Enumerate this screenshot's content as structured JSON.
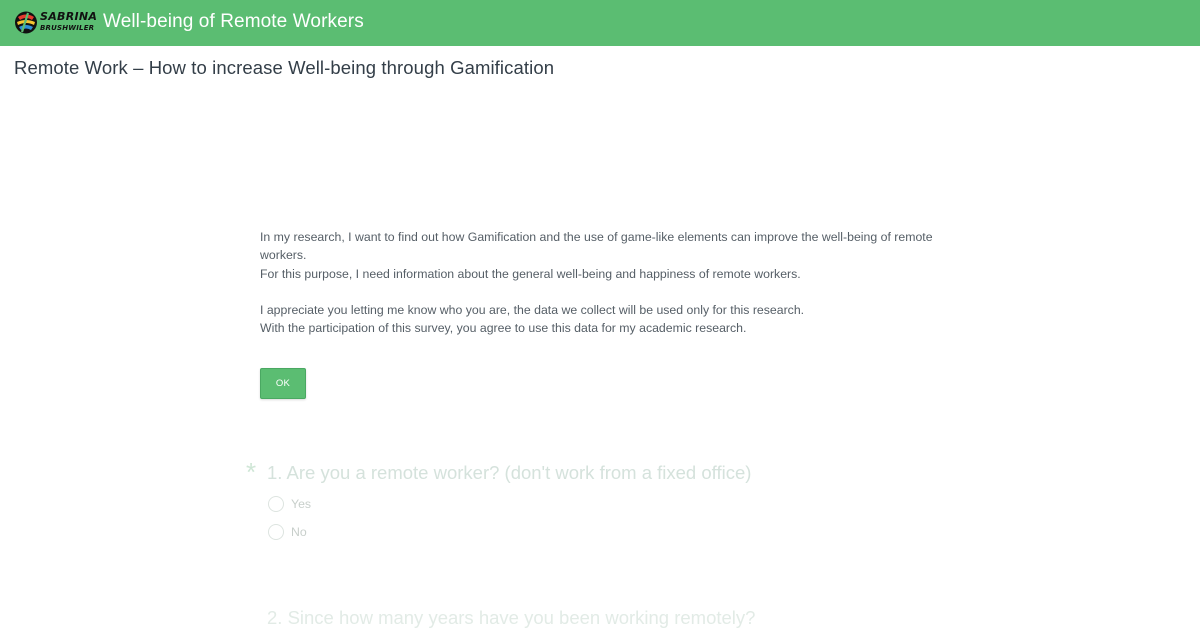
{
  "header": {
    "logo_line1": "SABRINA",
    "logo_line2": "BRUSHWILER",
    "title": "Well-being of Remote Workers"
  },
  "survey_title": "Remote Work – How to increase Well-being through Gamification",
  "intro": {
    "paragraph1_line1": "In my research, I want to find out how Gamification and the use of game-like elements can improve the well-being of remote workers.",
    "paragraph1_line2": "For this purpose, I need information about the general well-being and happiness of remote workers.",
    "paragraph2_line1": "I appreciate you letting me know who you are, the data we collect will be used only for this research.",
    "paragraph2_line2": "With the participation of this survey, you agree to use this data for my academic research."
  },
  "ok_button_label": "OK",
  "questions": [
    {
      "required_marker": "*",
      "text": "1. Are you a remote worker? (don't work from a fixed office)",
      "options": [
        "Yes",
        "No"
      ]
    },
    {
      "text": "2. Since how many years have you been working remotely?"
    }
  ],
  "colors": {
    "brand_green": "#5bbd72",
    "text_dark": "#333e48"
  },
  "icons": {
    "logo": "sabrina-brushwiler-logo-icon"
  }
}
